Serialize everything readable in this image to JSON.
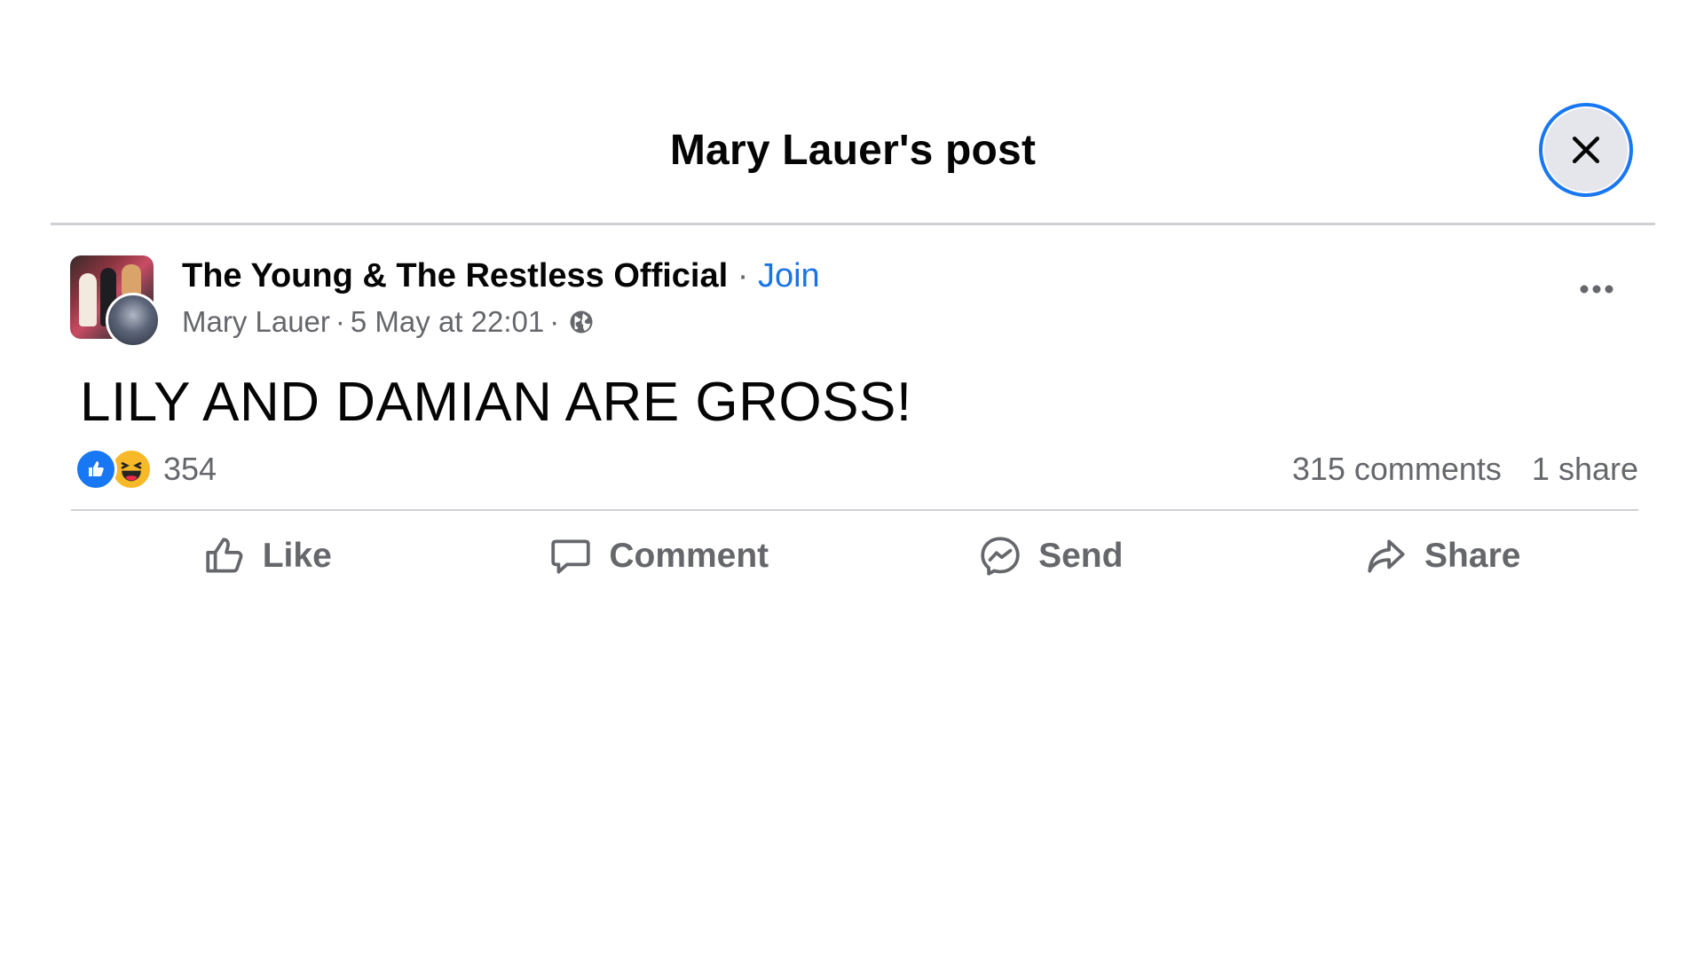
{
  "dialog": {
    "title": "Mary Lauer's post"
  },
  "post": {
    "group_name": "The Young & The Restless Official",
    "separator": " · ",
    "join_label": "Join",
    "author": "Mary Lauer",
    "meta_separator": " · ",
    "timestamp": "5 May at 22:01",
    "meta_separator_2": " ·",
    "text": "LILY AND DAMIAN ARE GROSS!"
  },
  "stats": {
    "reaction_count": "354",
    "reactions": [
      "like",
      "haha"
    ],
    "comments": "315 comments",
    "shares": "1 share"
  },
  "actions": {
    "like": "Like",
    "comment": "Comment",
    "send": "Send",
    "share": "Share"
  },
  "icons": {
    "close": "close-icon",
    "more": "more-horizontal-icon",
    "globe": "globe-icon",
    "like": "thumbs-up-icon",
    "comment": "comment-bubble-icon",
    "send": "messenger-icon",
    "share": "share-arrow-icon"
  },
  "colors": {
    "accent": "#1877f2",
    "link": "#1b74e4",
    "secondary_text": "#65676b",
    "haha": "#f7b928"
  }
}
